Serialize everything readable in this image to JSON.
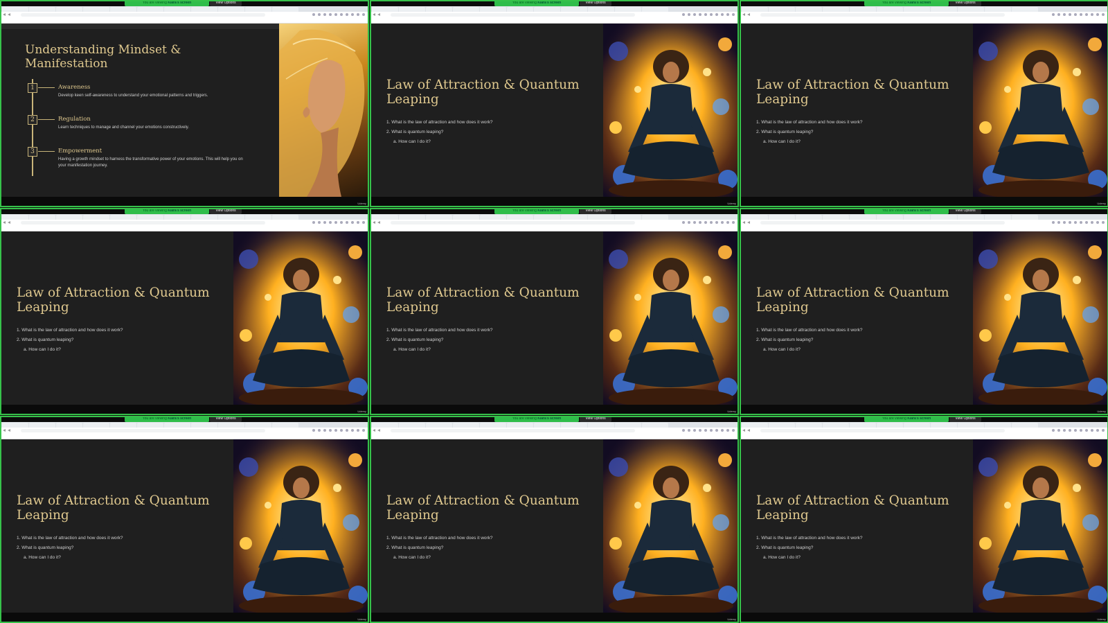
{
  "grid_cells": [
    {
      "type": "mindset",
      "viewing_text": "You are viewing",
      "viewing_name": "Kiara's screen",
      "view_options": "View Options",
      "footer": "Udemy",
      "highlight": true
    },
    {
      "type": "law",
      "viewing_text": "You are viewing",
      "viewing_name": "Kiara's screen",
      "view_options": "View Options",
      "footer": "Udemy",
      "highlight": false
    },
    {
      "type": "law",
      "viewing_text": "You are viewing",
      "viewing_name": "Kiara's screen",
      "view_options": "View Options",
      "footer": "Udemy",
      "highlight": false
    },
    {
      "type": "law",
      "viewing_text": "You are viewing",
      "viewing_name": "Kiara's screen",
      "view_options": "View Options",
      "footer": "Udemy",
      "highlight": false
    },
    {
      "type": "law",
      "viewing_text": "You are viewing",
      "viewing_name": "Kiara's screen",
      "view_options": "View Options",
      "footer": "Udemy",
      "highlight": false
    },
    {
      "type": "law",
      "viewing_text": "You are viewing",
      "viewing_name": "Kiara's screen",
      "view_options": "View Options",
      "footer": "Udemy",
      "highlight": false
    },
    {
      "type": "law",
      "viewing_text": "You are viewing",
      "viewing_name": "Kiara's screen",
      "view_options": "View Options",
      "footer": "Udemy",
      "highlight": false
    },
    {
      "type": "law",
      "viewing_text": "You are viewing",
      "viewing_name": "Kiara's screen",
      "view_options": "View Options",
      "footer": "Udemy",
      "highlight": false
    },
    {
      "type": "law",
      "viewing_text": "You are viewing",
      "viewing_name": "Kiara's screen",
      "view_options": "View Options",
      "footer": "Udemy",
      "highlight": false
    }
  ],
  "mindset_slide": {
    "title": "Understanding Mindset & Manifestation",
    "steps": [
      {
        "num": "1",
        "heading": "Awareness",
        "desc": "Develop keen self-awareness to understand your emotional patterns and triggers."
      },
      {
        "num": "2",
        "heading": "Regulation",
        "desc": "Learn techniques to manage and channel your emotions constructively."
      },
      {
        "num": "3",
        "heading": "Empowerment",
        "desc": "Having a growth mindset to harness the transformative power of your emotions. This will help you on your manifestation journey."
      }
    ]
  },
  "law_slide": {
    "title": "Law of Attraction & Quantum Leaping",
    "items": [
      "1.  What is the law of attraction and how does it work?",
      "2.  What is quantum leaping?",
      "a.  How can I do it?"
    ]
  },
  "colors": {
    "accent_gold": "#e0c98f",
    "zoom_green": "#2fbd4a",
    "slide_bg": "#1f1f1f"
  }
}
